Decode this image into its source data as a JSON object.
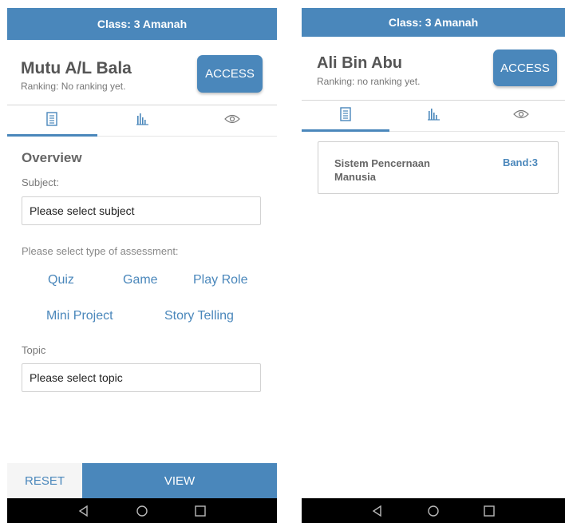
{
  "left_screen": {
    "class_title": "Class: 3 Amanah",
    "student_name": "Mutu A/L Bala",
    "ranking": "Ranking: No ranking yet.",
    "access_label": "ACCESS",
    "tabs": [
      {
        "icon": "document-icon",
        "active": true
      },
      {
        "icon": "bar-chart-icon",
        "active": false
      },
      {
        "icon": "eye-icon",
        "active": false
      }
    ],
    "overview_title": "Overview",
    "subject_label": "Subject:",
    "subject_placeholder": "Please select subject",
    "assessment_label": "Please select type of assessment:",
    "assessment_options": [
      "Quiz",
      "Game",
      "Play Role",
      "Mini Project",
      "Story Telling"
    ],
    "topic_label": "Topic",
    "topic_placeholder": "Please select topic",
    "reset_label": "RESET",
    "view_label": "VIEW"
  },
  "right_screen": {
    "class_title": "Class: 3 Amanah",
    "student_name": "Ali Bin Abu",
    "ranking": "Ranking: no ranking yet.",
    "access_label": "ACCESS",
    "tabs": [
      {
        "icon": "document-icon",
        "active": true
      },
      {
        "icon": "bar-chart-icon",
        "active": false
      },
      {
        "icon": "eye-icon",
        "active": false
      }
    ],
    "results": [
      {
        "topic": "Sistem Pencernaan Manusia",
        "band": "Band:3"
      }
    ]
  },
  "android_nav": {
    "buttons": [
      "back-icon",
      "home-icon",
      "recents-icon"
    ]
  },
  "colors": {
    "accent": "#4a87bb",
    "nav_bar": "#000000"
  }
}
